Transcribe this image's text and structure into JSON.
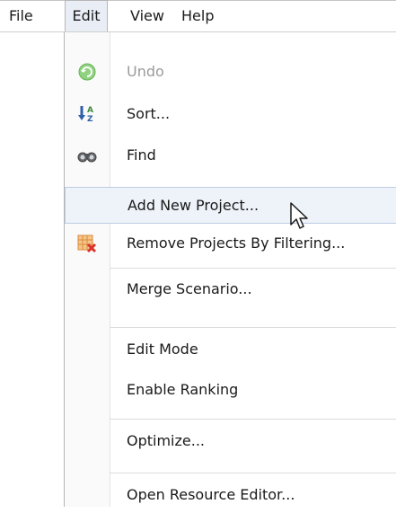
{
  "menubar": {
    "items": [
      {
        "label": "File"
      },
      {
        "label": "Edit"
      },
      {
        "label": "View"
      },
      {
        "label": "Help"
      }
    ],
    "open_item": "Edit"
  },
  "edit_menu": {
    "items": [
      {
        "label": "Undo",
        "icon": "undo-icon",
        "enabled": false
      },
      {
        "label": "Sort...",
        "icon": "sort-icon",
        "enabled": true
      },
      {
        "label": "Find",
        "icon": "find-icon",
        "enabled": true
      },
      {
        "label": "Add New Project...",
        "icon": "",
        "enabled": true,
        "highlighted": true
      },
      {
        "label": "Remove Projects By Filtering...",
        "icon": "remove-filter-icon",
        "enabled": true
      },
      {
        "label": "Merge Scenario...",
        "icon": "",
        "enabled": true
      },
      {
        "label": "Edit Mode",
        "icon": "",
        "enabled": true
      },
      {
        "label": "Enable Ranking",
        "icon": "",
        "enabled": true
      },
      {
        "label": "Optimize...",
        "icon": "",
        "enabled": true
      },
      {
        "label": "Open Resource Editor...",
        "icon": "",
        "enabled": true
      }
    ]
  },
  "colors": {
    "open_menu_bg": "#e9eef6",
    "highlight_bg": "#eef3fa",
    "highlight_border": "#bccde4",
    "disabled_text": "#9a9a9a"
  }
}
